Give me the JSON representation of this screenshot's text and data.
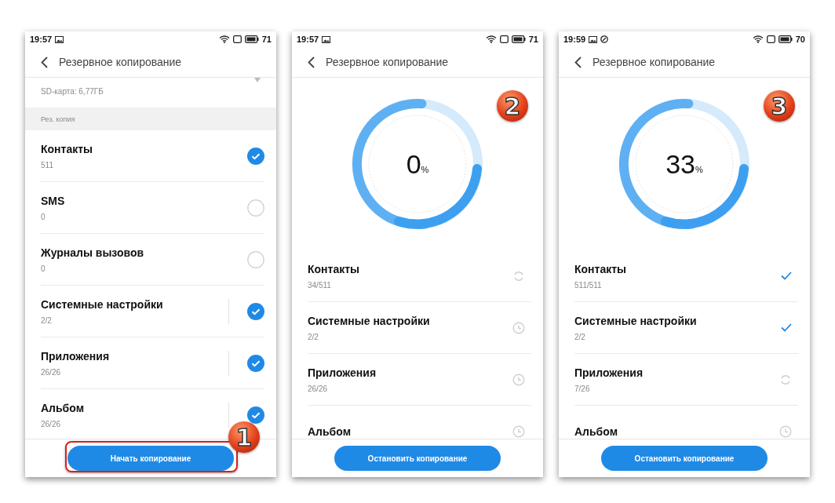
{
  "screens": [
    {
      "kind": "selection",
      "status_bar": {
        "time": "19:57",
        "second_notification_icon": false,
        "battery": "71"
      },
      "title": "Резервное копирование",
      "storage": {
        "detail": "SD-карта: 6,77ГБ"
      },
      "section": "Рез. копия",
      "items": [
        {
          "name": "Контакты",
          "count": "511",
          "checked": true,
          "separator": false
        },
        {
          "name": "SMS",
          "count": "0",
          "checked": false,
          "separator": false
        },
        {
          "name": "Журналы вызовов",
          "count": "0",
          "checked": false,
          "separator": false
        },
        {
          "name": "Системные настройки",
          "count": "2/2",
          "checked": true,
          "separator": true
        },
        {
          "name": "Приложения",
          "count": "26/26",
          "checked": true,
          "separator": true
        },
        {
          "name": "Альбом",
          "count": "26/26",
          "checked": true,
          "separator": true
        }
      ],
      "button": "Начать копирование",
      "button_highlighted": true,
      "step": "1"
    },
    {
      "kind": "progress",
      "status_bar": {
        "time": "19:57",
        "second_notification_icon": false,
        "battery": "71"
      },
      "title": "Резервное копирование",
      "percent": "0",
      "percent_sign": "%",
      "items": [
        {
          "name": "Контакты",
          "count": "34/511",
          "kind": "syncing"
        },
        {
          "name": "Системные настройки",
          "count": "2/2",
          "kind": "waiting"
        },
        {
          "name": "Приложения",
          "count": "26/26",
          "kind": "waiting"
        },
        {
          "name": "Альбом",
          "kind": "waiting"
        }
      ],
      "button": "Остановить копирование",
      "button_highlighted": false,
      "step": "2"
    },
    {
      "kind": "progress",
      "status_bar": {
        "time": "19:59",
        "second_notification_icon": true,
        "battery": "70"
      },
      "title": "Резервное копирование",
      "percent": "33",
      "percent_sign": "%",
      "items": [
        {
          "name": "Контакты",
          "count": "511/511",
          "kind": "done"
        },
        {
          "name": "Системные настройки",
          "count": "2/2",
          "kind": "done"
        },
        {
          "name": "Приложения",
          "count": "7/26",
          "kind": "syncing"
        },
        {
          "name": "Альбом",
          "kind": "waiting"
        }
      ],
      "button": "Остановить копирование",
      "button_highlighted": false,
      "step": "3"
    }
  ]
}
